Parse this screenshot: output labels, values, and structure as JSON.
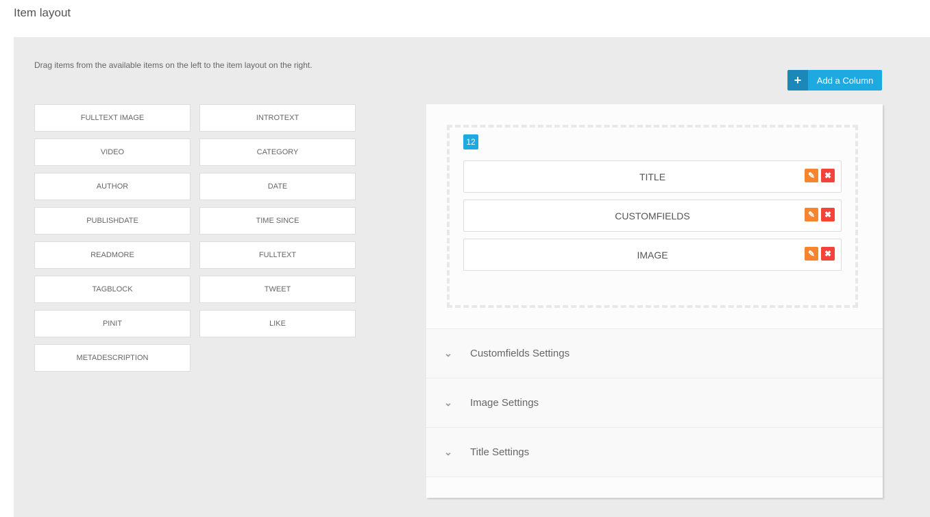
{
  "page": {
    "title": "Item layout",
    "hint": "Drag items from the available items on the left to the item layout on the right."
  },
  "available_items": [
    "FULLTEXT IMAGE",
    "INTROTEXT",
    "VIDEO",
    "CATEGORY",
    "AUTHOR",
    "DATE",
    "PUBLISHDATE",
    "TIME SINCE",
    "READMORE",
    "FULLTEXT",
    "TAGBLOCK",
    "TWEET",
    "PINIT",
    "LIKE",
    "METADESCRIPTION"
  ],
  "toolbar": {
    "add_column_label": "Add a Column",
    "add_icon": "+"
  },
  "layout": {
    "column_width": "12",
    "items": [
      "TITLE",
      "CUSTOMFIELDS",
      "IMAGE"
    ]
  },
  "settings": [
    "Customfields Settings",
    "Image Settings",
    "Title Settings"
  ],
  "colors": {
    "accent": "#1fa9e1",
    "edit": "#f7842f",
    "delete": "#f4433b"
  }
}
